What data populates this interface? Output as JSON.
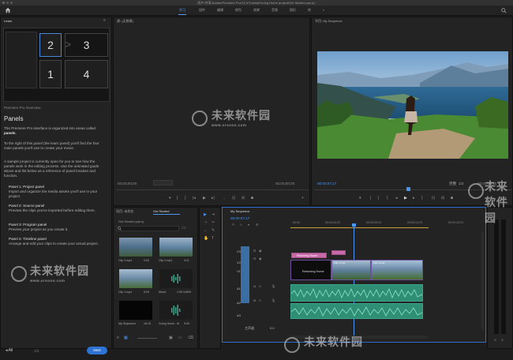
{
  "window": {
    "title": "/用户/共享/Adobe/Premiere Pro/13.0/Tutorial/Going Home project/Get Started.prproj *"
  },
  "workspaces": [
    "学习",
    "组件",
    "编辑",
    "颜色",
    "效果",
    "音频",
    "图形",
    "库"
  ],
  "learn_panel": {
    "tab": "Learn",
    "grid_numbers": [
      "2",
      "3",
      "1",
      "4"
    ],
    "section": "Premiere Pro Overview",
    "heading": "Panels",
    "intro_pre": "The Premiere Pro interface is organized into areas called",
    "intro_bold": "panels",
    "para1": "To the right of this panel (the learn panel) you'll find the four main panels you'll use to create your movie.",
    "para2": "A sample project is currently open for you to see how the panels work in the editing process. Use the animated guide above and list below as a reference of panel location and function.",
    "bullets": [
      {
        "title": "Panel 1: Project panel",
        "desc": "Import and organize the media assets you'll use in your project."
      },
      {
        "title": "Panel 2: Source panel",
        "desc": "Preview the clips you've imported before editing them."
      },
      {
        "title": "Panel 3: Program panel",
        "desc": "Preview your project as you create it."
      },
      {
        "title": "Panel 4: Timeline panel",
        "desc": "Arrange and edit your clips to create your actual project."
      }
    ],
    "all_label": "All",
    "page": "1/3",
    "next_label": "Next"
  },
  "source_panel": {
    "tab": "源: (无剪辑)",
    "timecode_left": "00;00;00;00",
    "timecode_right": "00;00;00;00"
  },
  "program_panel": {
    "tab": "节目: My Sequence",
    "timecode_left": "00:00:07:17",
    "fit": "完整",
    "timecode_right": "00:00:18:10",
    "zoom": "1/2"
  },
  "project_panel": {
    "tabs": [
      "项目: 未命名",
      "Get Started"
    ],
    "file": "Get Started.prproj",
    "items": [
      {
        "name": "Clip 3.mp4",
        "duration": "0:00"
      },
      {
        "name": "Clip 2.mp4",
        "duration": "4:11"
      },
      {
        "name": "Clip 1.mp4",
        "duration": "5:09"
      },
      {
        "name": "Music",
        "duration": "1:09:14909"
      },
      {
        "name": "My Sequence",
        "duration": "18:10"
      },
      {
        "name": "Going Home - ttl",
        "duration": "5:00"
      }
    ]
  },
  "timeline_panel": {
    "tab": "My Sequence",
    "timecode": "00:00:07:17",
    "ruler": [
      ":00:00",
      "00:00:04:23",
      "00:00:09:23",
      "00:00:14:23",
      "00:00:19:23"
    ],
    "tracks": [
      "V3",
      "V2",
      "V1",
      "A1",
      "A2",
      "A3",
      "主声道"
    ],
    "master_value": "0.0",
    "title_clip": "Returning Home",
    "clip_labels": [
      "Returning Home",
      "Clip 2.mp4",
      "Clip 3.mp4"
    ]
  },
  "watermark": {
    "text": "未来软件园",
    "url": "www.orsoon.com"
  },
  "colors": {
    "accent": "#2d73d4",
    "clip_video": "#7a5fb0",
    "clip_audio": "#3aa58a",
    "playhead": "#4c95f0"
  }
}
